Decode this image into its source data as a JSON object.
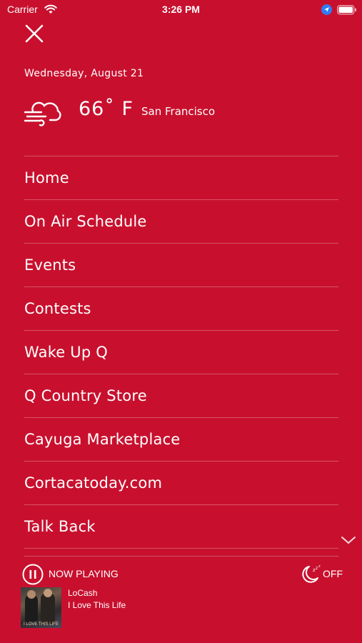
{
  "status_bar": {
    "carrier": "Carrier",
    "time": "3:26 PM"
  },
  "header": {
    "close_icon": "close-icon"
  },
  "date": "Wednesday, August 21",
  "weather": {
    "icon": "cloud-wind-icon",
    "temperature": "66˚ F",
    "city": "San Francisco"
  },
  "menu": {
    "items": [
      {
        "label": "Home"
      },
      {
        "label": "On Air Schedule"
      },
      {
        "label": "Events"
      },
      {
        "label": "Contests"
      },
      {
        "label": "Wake Up Q"
      },
      {
        "label": "Q Country Store"
      },
      {
        "label": "Cayuga Marketplace"
      },
      {
        "label": "Cortacatoday.com"
      },
      {
        "label": "Talk Back"
      }
    ]
  },
  "player": {
    "now_playing_label": "NOW PLAYING",
    "sleep_timer_label": "OFF",
    "artist": "LoCash",
    "track": "I Love This Life",
    "album_caption": "I LOVE THIS LIFE"
  },
  "colors": {
    "background": "#c8102e",
    "text": "#ffffff"
  }
}
